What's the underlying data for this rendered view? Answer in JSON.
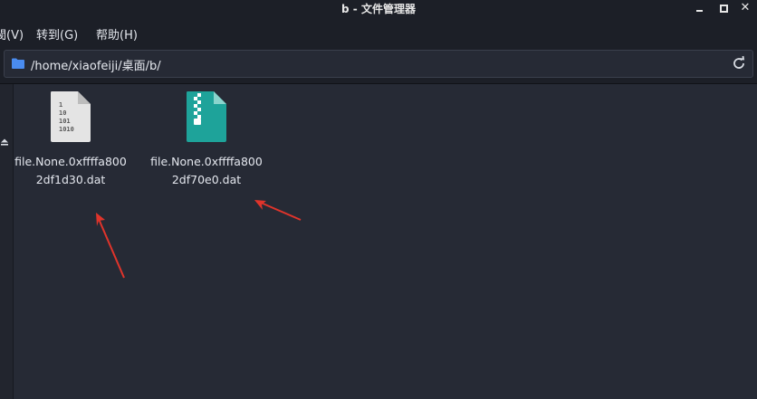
{
  "window": {
    "title": "b - 文件管理器",
    "close_glyph": "✕"
  },
  "menubar": {
    "items": [
      {
        "label": "閥(V)"
      },
      {
        "label": "转到(G)"
      },
      {
        "label": "帮助(H)"
      }
    ]
  },
  "location": {
    "path": "/home/xiaofeiji/桌面/b/"
  },
  "files": [
    {
      "name": "file.None.0xffffa8002df1d30.dat",
      "icon": "binary-file-icon"
    },
    {
      "name": "file.None.0xffffa8002df70e0.dat",
      "icon": "archive-file-icon"
    }
  ],
  "colors": {
    "background": "#262a35",
    "chrome": "#1c1f27",
    "accent_folder": "#4a8cf0",
    "archive_icon": "#1ea39a",
    "annotation_arrow": "#e0342b"
  }
}
